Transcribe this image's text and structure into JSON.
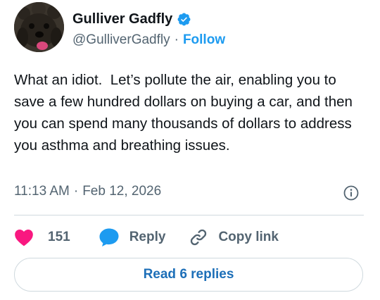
{
  "author": {
    "display_name": "Gulliver Gadfly",
    "handle": "@GulliverGadfly",
    "separator": "·",
    "follow_label": "Follow",
    "avatar_icon": "dog-avatar",
    "verified_icon": "verified-badge-icon"
  },
  "tweet": {
    "text": "What an idiot.  Let’s pollute the air, enabling you to save a few hundred dollars on buying a car, and then you can spend many thousands of dollars to address you asthma and breathing issues.",
    "time": "11:13 AM",
    "separator": "·",
    "date": "Feb 12, 2026"
  },
  "actions": {
    "like_count": "151",
    "reply_label": "Reply",
    "copy_label": "Copy link"
  },
  "read_replies_label": "Read 6 replies",
  "colors": {
    "accent": "#1d9bf0",
    "like": "#f91880",
    "reply_bubble": "#1d9bf0",
    "muted": "#536471",
    "text": "#0f1419",
    "border": "#cfd9de"
  }
}
